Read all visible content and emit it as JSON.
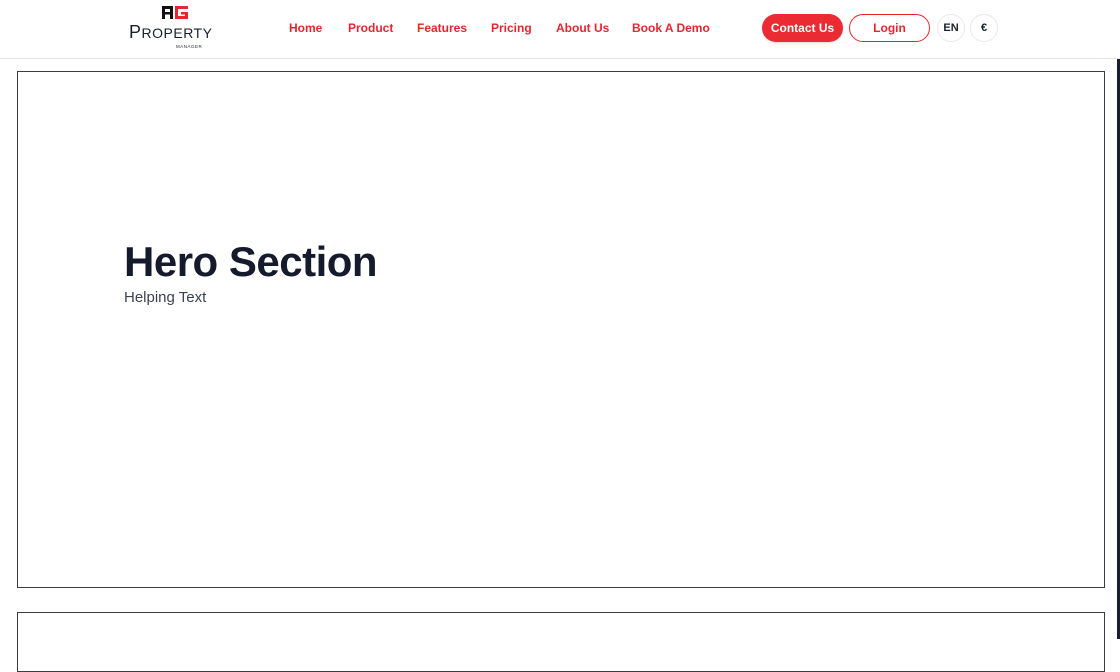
{
  "brand": {
    "logo_mark": "AG",
    "name_first": "P",
    "name_rest": "ROPERTY",
    "tagline": "MANAGER",
    "accent_color": "#e5262f",
    "dark_color": "#1a1f2e"
  },
  "nav": {
    "items": [
      {
        "label": "Home"
      },
      {
        "label": "Product"
      },
      {
        "label": "Features"
      },
      {
        "label": "Pricing"
      },
      {
        "label": "About Us"
      },
      {
        "label": "Book A Demo"
      }
    ]
  },
  "actions": {
    "contact_label": "Contact Us",
    "login_label": "Login",
    "language_label": "EN",
    "currency_label": "€"
  },
  "hero": {
    "title": "Hero Section",
    "subtitle": "Helping Text"
  }
}
